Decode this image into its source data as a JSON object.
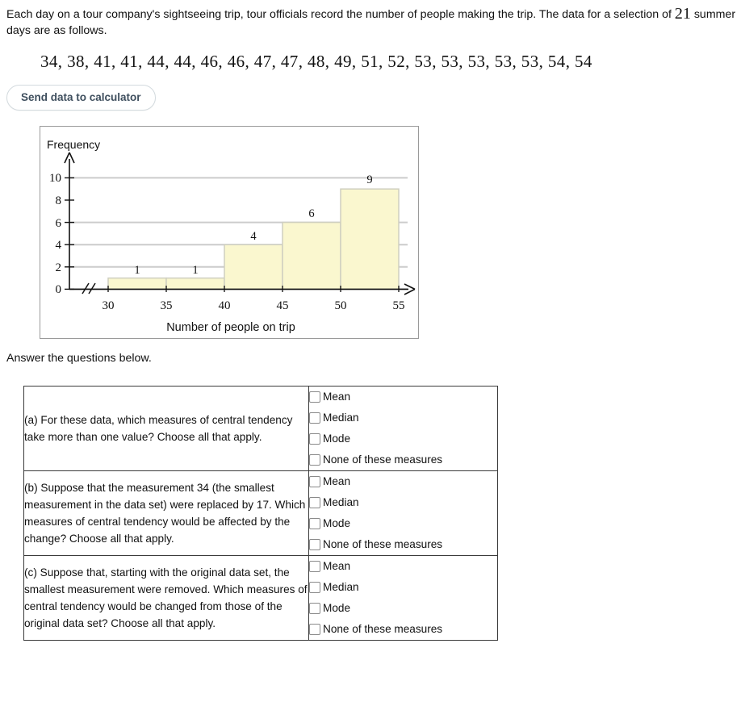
{
  "intro": {
    "text_before": "Each day on a tour company's sightseeing trip, tour officials record the number of people making the trip. The data for a selection of ",
    "count": "21",
    "text_after": " summer days are as follows."
  },
  "data_list": "34, 38, 41, 41, 44, 44, 46, 46, 47, 47, 48, 49, 51, 52, 53, 53, 53, 53, 53, 54, 54",
  "send_button": {
    "label": "Send data to calculator"
  },
  "answer_prompt": "Answer the questions below.",
  "chart_data": {
    "type": "bar",
    "title": "",
    "xlabel": "Number of people on trip",
    "ylabel": "Frequency",
    "categories": [
      "30-35",
      "35-40",
      "40-45",
      "45-50",
      "50-55"
    ],
    "bin_edges": [
      30,
      35,
      40,
      45,
      50,
      55
    ],
    "values": [
      1,
      1,
      4,
      6,
      9
    ],
    "bar_labels": [
      "1",
      "1",
      "4",
      "6",
      "9"
    ],
    "x_tick_labels": [
      "30",
      "35",
      "40",
      "45",
      "50",
      "55"
    ],
    "y_tick_labels": [
      "0",
      "2",
      "4",
      "6",
      "8",
      "10"
    ],
    "y_ticks": [
      0,
      2,
      4,
      6,
      8,
      10
    ],
    "ylim": [
      0,
      11
    ],
    "grid": true,
    "axis_break": true,
    "legend": "none",
    "bar_fill": "#faf7cf",
    "bar_stroke": "#cfcfc0"
  },
  "questions": [
    {
      "name": "question-a",
      "text": "(a) For these data, which measures of central tendency take more than one value? Choose all that apply.",
      "options": [
        {
          "label": "Mean",
          "checked": false
        },
        {
          "label": "Median",
          "checked": false
        },
        {
          "label": "Mode",
          "checked": false
        },
        {
          "label": "None of these measures",
          "checked": false
        }
      ]
    },
    {
      "name": "question-b",
      "text": "(b) Suppose that the measurement 34 (the smallest measurement in the data set) were replaced by 17. Which measures of central tendency would be affected by the change? Choose all that apply.",
      "options": [
        {
          "label": "Mean",
          "checked": false
        },
        {
          "label": "Median",
          "checked": false
        },
        {
          "label": "Mode",
          "checked": false
        },
        {
          "label": "None of these measures",
          "checked": false
        }
      ]
    },
    {
      "name": "question-c",
      "text": "(c) Suppose that, starting with the original data set, the smallest measurement were removed. Which measures of central tendency would be changed from those of the original data set? Choose all that apply.",
      "options": [
        {
          "label": "Mean",
          "checked": false
        },
        {
          "label": "Median",
          "checked": false
        },
        {
          "label": "Mode",
          "checked": false
        },
        {
          "label": "None of these measures",
          "checked": false
        }
      ]
    }
  ]
}
